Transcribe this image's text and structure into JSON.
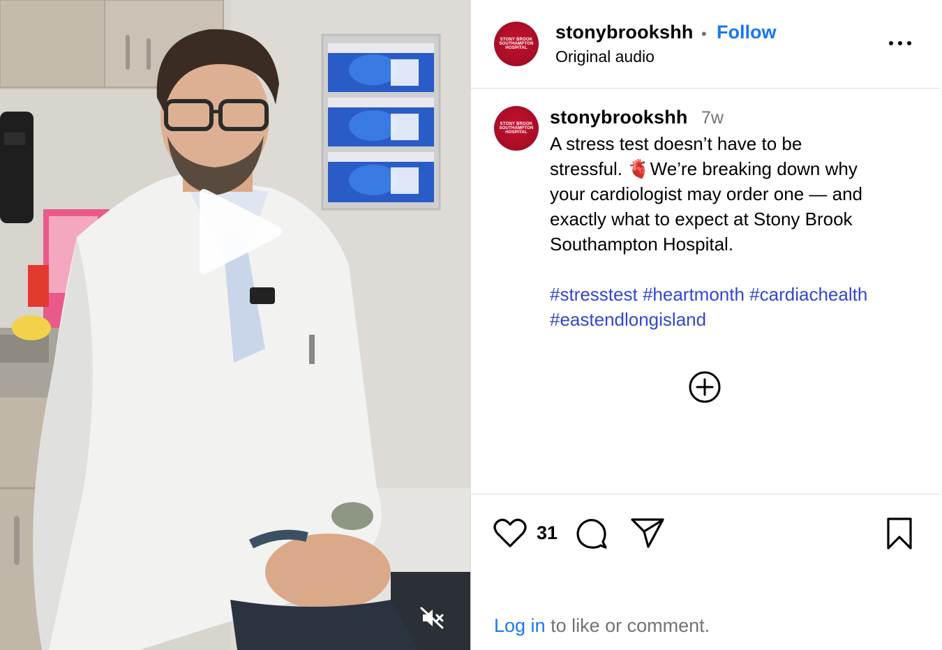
{
  "video": {
    "play_icon": "play-icon",
    "mute_icon": "speaker-muted-icon"
  },
  "header": {
    "avatar_lines": [
      "STONY BROOK",
      "SOUTHAMPTON",
      "HOSPITAL"
    ],
    "username": "stonybrookshh",
    "separator": "•",
    "follow_label": "Follow",
    "audio_label": "Original audio",
    "more_icon": "more-options-icon"
  },
  "caption": {
    "username": "stonybrookshh",
    "age": "7w",
    "lines": [
      "A stress test doesn’t have to be",
      "stressful. 🫀We’re breaking down why",
      "your cardiologist may order one — and",
      "exactly what to expect at Stony Brook",
      "Southampton Hospital."
    ],
    "hashtags": [
      "#stresstest",
      "#heartmonth",
      "#cardiachealth",
      "#eastendlongisland"
    ],
    "load_more_icon": "plus-circle-icon"
  },
  "actions": {
    "like_count": "31",
    "icons": [
      "heart-icon",
      "comment-icon",
      "share-icon",
      "bookmark-icon"
    ],
    "login_link": "Log in",
    "login_text": " to like or comment."
  },
  "colors": {
    "link_blue": "#1877f2",
    "hashtag_blue": "#3346d3",
    "muted_gray": "#737373",
    "brand_red": "#c8102e",
    "divider": "#dbdbdb"
  }
}
